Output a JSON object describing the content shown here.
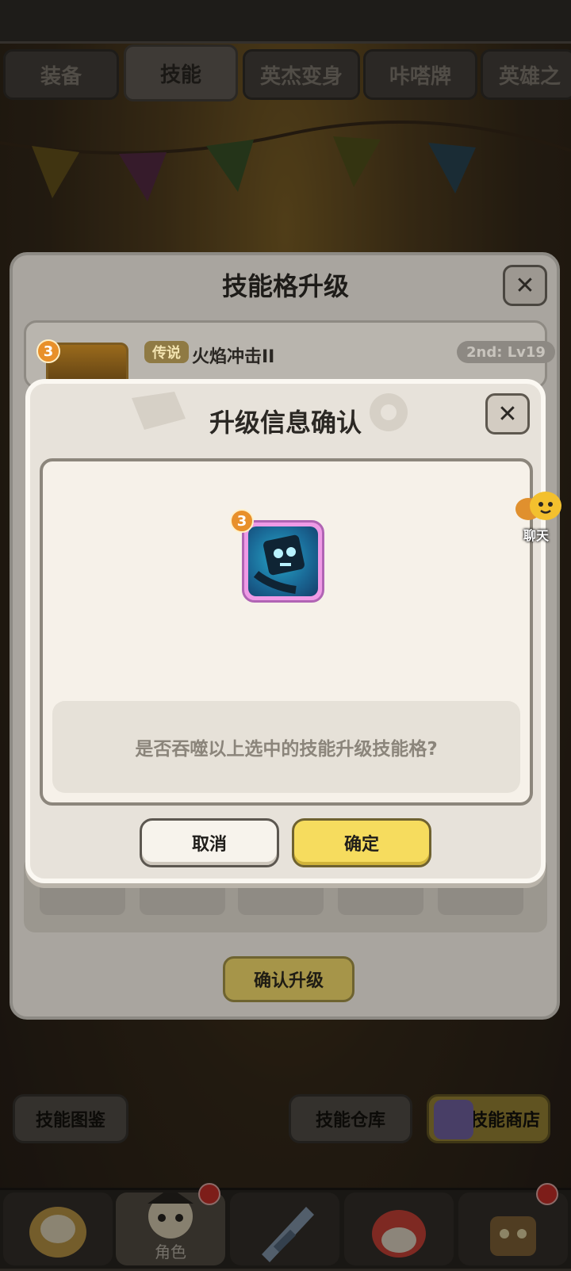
{
  "tabs": [
    {
      "label": "装备",
      "active": false
    },
    {
      "label": "技能",
      "active": true
    },
    {
      "label": "英杰变身",
      "active": false
    },
    {
      "label": "咔嗒牌",
      "active": false
    },
    {
      "label": "英雄之",
      "active": false
    }
  ],
  "upgrade_panel": {
    "title": "技能格升级",
    "close_icon": "close-icon",
    "skill": {
      "rarity_tag": "传说",
      "name": "火焰冲击II",
      "level_badge": "2nd: Lv19",
      "star_count": "3"
    },
    "confirm_button": "确认升级"
  },
  "confirm_modal": {
    "title": "升级信息确认",
    "close_icon": "close-icon",
    "selected_skill_star": "3",
    "question": "是否吞噬以上选中的技能升级技能格?",
    "cancel_label": "取消",
    "ok_label": "确定"
  },
  "chat": {
    "label": "聊天"
  },
  "lower_buttons": {
    "codex": "技能图鉴",
    "storage": "技能仓库",
    "shop": "技能商店"
  },
  "bottom_nav": {
    "active_label": "角色",
    "items": [
      "hero-portrait-1",
      "role-portrait",
      "weapon-icon",
      "pet-icon",
      "monster-icon"
    ]
  },
  "colors": {
    "accent_yellow": "#f6dc5e",
    "legend_tag": "#8f7a44",
    "badge_orange": "#e8902a",
    "notification_red": "#d8322c"
  }
}
